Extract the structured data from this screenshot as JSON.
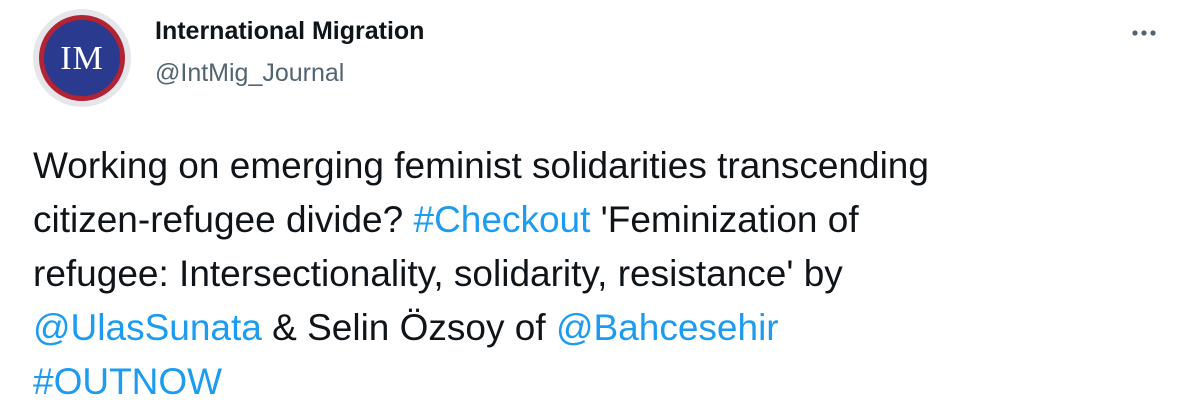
{
  "author": {
    "avatar_initials": "IM",
    "display_name": "International Migration",
    "handle": "@IntMig_Journal"
  },
  "menu": {
    "icon": "more-horizontal-icon"
  },
  "tweet": {
    "lines": [
      [
        {
          "text": "Working on emerging feminist solidarities transcending",
          "link": false
        }
      ],
      [
        {
          "text": "citizen-refugee divide? ",
          "link": false
        },
        {
          "text": "#Checkout",
          "link": true,
          "kind": "hashtag"
        },
        {
          "text": " 'Feminization of",
          "link": false
        }
      ],
      [
        {
          "text": "refugee: Intersectionality, solidarity, resistance' by",
          "link": false
        }
      ],
      [
        {
          "text": "@UlasSunata",
          "link": true,
          "kind": "mention"
        },
        {
          "text": " & Selin Özsoy of ",
          "link": false
        },
        {
          "text": "@Bahcesehir",
          "link": true,
          "kind": "mention"
        }
      ],
      [
        {
          "text": "#OUTNOW",
          "link": true,
          "kind": "hashtag"
        }
      ]
    ]
  },
  "colors": {
    "text": "#0f1419",
    "secondary": "#536471",
    "link": "#1d9bf0",
    "avatar_blue": "#2a3a8f",
    "avatar_red": "#b22334"
  }
}
